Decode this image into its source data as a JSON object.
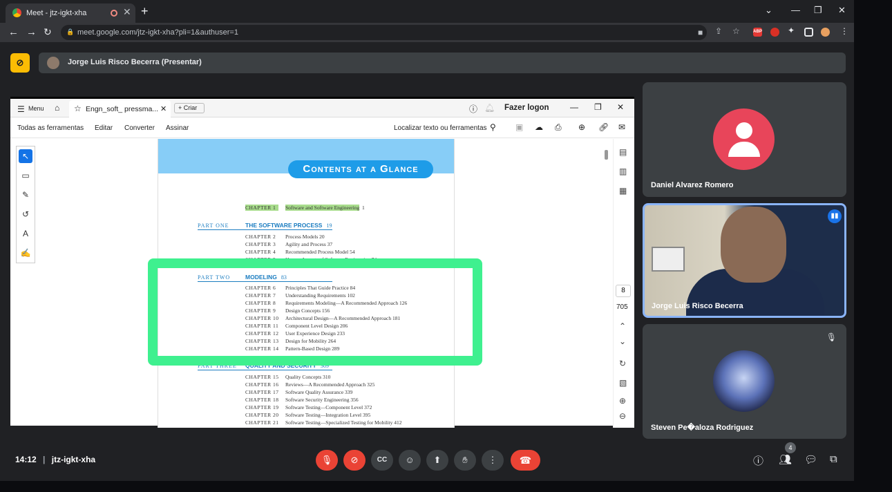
{
  "browser": {
    "tab_title": "Meet - jtz-igkt-xha",
    "new_tab": "+",
    "url": "meet.google.com/jtz-igkt-xha?pli=1&authuser=1",
    "ext_abp": "ABP"
  },
  "meet": {
    "presenter_name": "Jorge Luis Risco Becerra (Presentar)",
    "time": "14:12",
    "separator": "|",
    "meeting_code": "jtz-igkt-xha",
    "participant_count": "4",
    "participants": [
      {
        "name": "Daniel Alvarez Romero"
      },
      {
        "name": "Jorge Luis Risco Becerra"
      },
      {
        "name": "Steven Pe�aloza Rodriguez"
      }
    ]
  },
  "acrobat": {
    "menu": "Menu",
    "tab_title": "Engn_soft_ pressma...",
    "create": "Criar",
    "login": "Fazer logon",
    "toolbar": [
      "Todas as ferramentas",
      "Editar",
      "Converter",
      "Assinar"
    ],
    "search": "Localizar texto ou ferramentas",
    "page_num": "8",
    "page_total": "705"
  },
  "document": {
    "header": "Contents at a Glance",
    "chapter1": {
      "label": "CHAPTER 1",
      "title": "Software and Software Engineering",
      "page": "1"
    },
    "part1": {
      "label": "PART ONE",
      "title": "THE SOFTWARE PROCESS",
      "page": "19",
      "chapters": [
        {
          "label": "CHAPTER 2",
          "text": "Process Models   20"
        },
        {
          "label": "CHAPTER 3",
          "text": "Agility and Process   37"
        },
        {
          "label": "CHAPTER 4",
          "text": "Recommended Process Model   54"
        },
        {
          "label": "CHAPTER 5",
          "text": "Human Aspects of Software Engineering   74"
        }
      ]
    },
    "part2": {
      "label": "PART TWO",
      "title": "MODELING",
      "page": "83",
      "chapters": [
        {
          "label": "CHAPTER 6",
          "text": "Principles That Guide Practice   84"
        },
        {
          "label": "CHAPTER 7",
          "text": "Understanding Requirements   102"
        },
        {
          "label": "CHAPTER 8",
          "text": "Requirements Modeling—A Recommended Approach   126"
        },
        {
          "label": "CHAPTER 9",
          "text": "Design Concepts   156"
        },
        {
          "label": "CHAPTER 10",
          "text": "Architectural Design—A Recommended Approach   181"
        },
        {
          "label": "CHAPTER 11",
          "text": "Component Level Design   206"
        },
        {
          "label": "CHAPTER 12",
          "text": "User Experience Design   233"
        },
        {
          "label": "CHAPTER 13",
          "text": "Design for Mobility   264"
        },
        {
          "label": "CHAPTER 14",
          "text": "Pattern-Based Design   289"
        }
      ]
    },
    "part3": {
      "label": "PART THREE",
      "title": "QUALITY AND SECURITY",
      "page": "309",
      "chapters": [
        {
          "label": "CHAPTER 15",
          "text": "Quality Concepts   310"
        },
        {
          "label": "CHAPTER 16",
          "text": "Reviews—A Recommended Approach   325"
        },
        {
          "label": "CHAPTER 17",
          "text": "Software Quality Assurance   339"
        },
        {
          "label": "CHAPTER 18",
          "text": "Software Security Engineering   356"
        },
        {
          "label": "CHAPTER 19",
          "text": "Software Testing—Component Level   372"
        },
        {
          "label": "CHAPTER 20",
          "text": "Software Testing—Integration Level   395"
        },
        {
          "label": "CHAPTER 21",
          "text": "Software Testing—Specialized Testing for Mobility   412"
        }
      ]
    }
  },
  "colors": {
    "highlight": "#3ff08f",
    "accent": "#1e9ce8",
    "hangup": "#ea4335",
    "presenter": "#fbbc04"
  }
}
